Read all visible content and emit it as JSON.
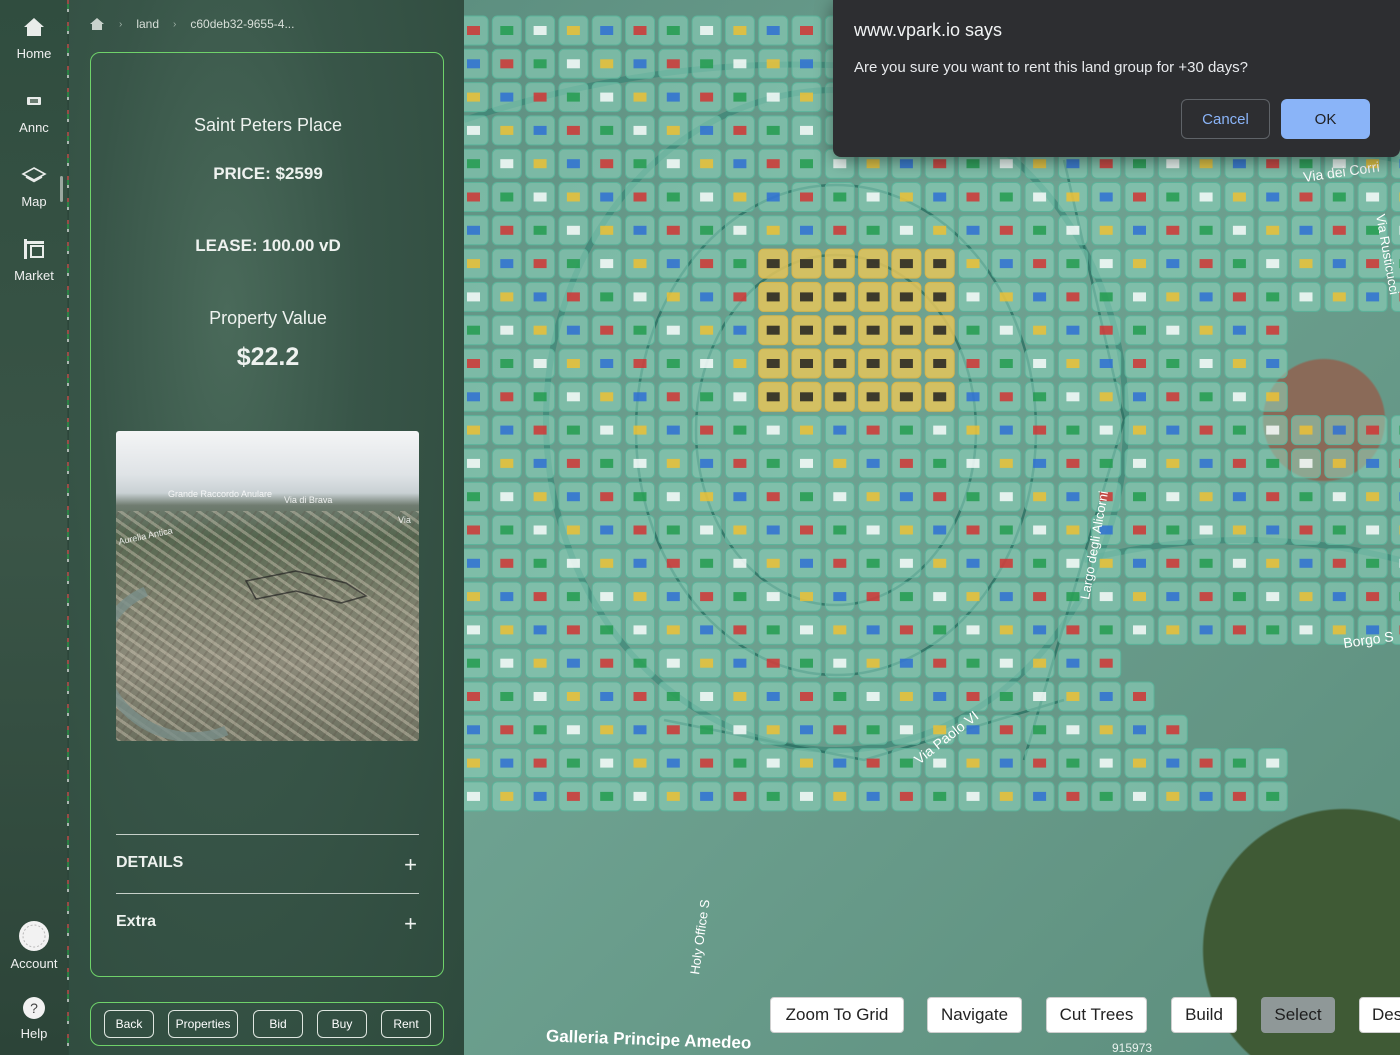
{
  "nav": {
    "home": "Home",
    "annc": "Annc",
    "map": "Map",
    "market": "Market",
    "account": "Account",
    "help": "Help"
  },
  "breadcrumb": {
    "section": "land",
    "id": "c60deb32-9655-4..."
  },
  "property": {
    "name": "Saint Peters Place",
    "price": "PRICE: $2599",
    "lease": "LEASE: 100.00 vD",
    "value_label": "Property Value",
    "value": "$22.2",
    "preview_labels": {
      "aurelia": "Aurelia Antica",
      "raccordo": "Grande Raccordo Anulare",
      "brava": "Via di Brava",
      "via": "Via"
    }
  },
  "accordion": {
    "details": "DETAILS",
    "extra": "Extra",
    "toggle": "+"
  },
  "actions": {
    "back": "Back",
    "properties": "Properties",
    "bid": "Bid",
    "buy": "Buy",
    "rent": "Rent"
  },
  "map": {
    "labels": {
      "viadei": "Via dei Corri",
      "rusticucci": "Via Rusticucci",
      "largo": "Largo degli Alicorni",
      "borgo": "Borgo S",
      "paolo": "Via Paolo VI",
      "holy": "Holy Office S",
      "galleria": "Galleria Principe Amedeo"
    },
    "code": "915973"
  },
  "tools": {
    "zoom": "Zoom To Grid",
    "navigate": "Navigate",
    "cut": "Cut Trees",
    "build": "Build",
    "select": "Select",
    "des": "Des"
  },
  "dialog": {
    "title": "www.vpark.io says",
    "message": "Are you sure you want to rent this land group for +30 days?",
    "cancel": "Cancel",
    "ok": "OK"
  },
  "colors": {
    "accent": "#6fd26a",
    "selection": "#e5c65a",
    "tile": "#8fd7bf",
    "dialog_ok": "#8ab4f8"
  }
}
